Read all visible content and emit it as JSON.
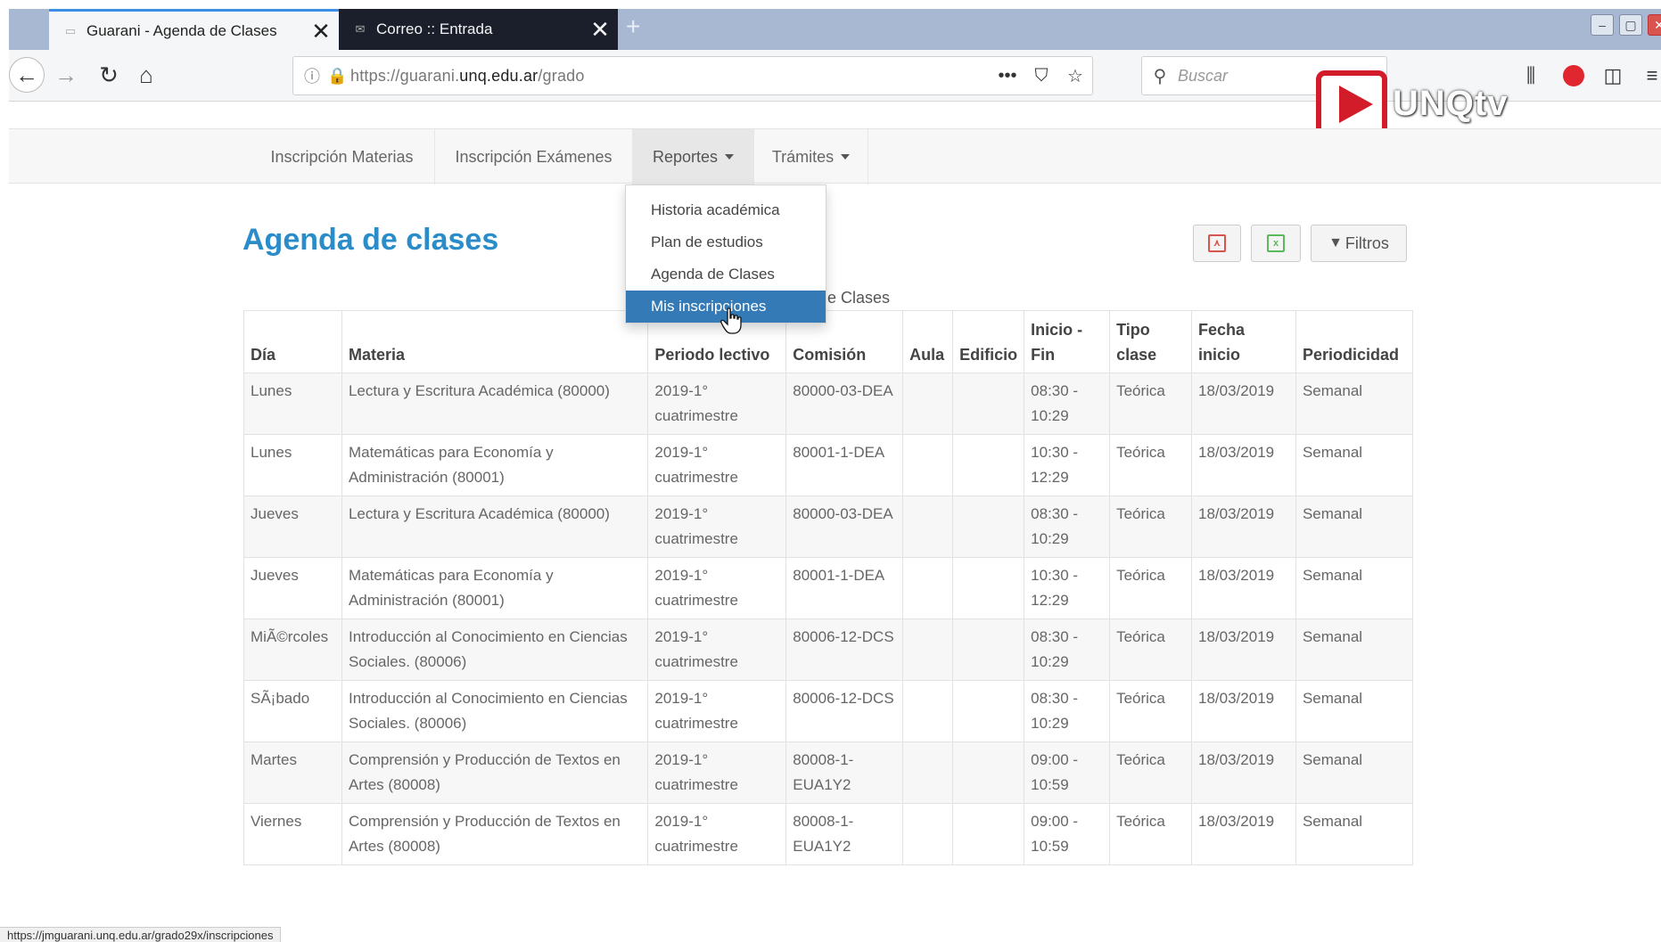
{
  "browser": {
    "tabs": [
      {
        "title": "Guarani - Agenda de Clases",
        "close": "✕"
      },
      {
        "title": "Correo :: Entrada",
        "close": "✕"
      }
    ],
    "new_tab": "+",
    "url_prefix": "https://guarani.",
    "url_domain": "unq.edu.ar",
    "url_path": "/grado",
    "url_more": "•••",
    "search_placeholder": "Buscar",
    "status_url": "https://jmguarani.unq.edu.ar/grado29x/inscripciones"
  },
  "watermark": {
    "text": "UNQtv"
  },
  "nav": {
    "items": [
      {
        "label": "Inscripción Materias"
      },
      {
        "label": "Inscripción Exámenes"
      },
      {
        "label": "Reportes"
      },
      {
        "label": "Trámites"
      }
    ]
  },
  "reportes_menu": {
    "items": [
      {
        "label": "Historia académica"
      },
      {
        "label": "Plan de estudios"
      },
      {
        "label": "Agenda de Clases"
      },
      {
        "label": "Mis inscripciones"
      }
    ]
  },
  "page": {
    "title": "Agenda de clases",
    "filter_label": "Filtros",
    "caption": "de Clases"
  },
  "table": {
    "headers": [
      "Día",
      "Materia",
      "Periodo lectivo",
      "Comisión",
      "Aula",
      "Edificio",
      "Inicio - Fin",
      "Tipo clase",
      "Fecha inicio",
      "Periodicidad"
    ],
    "rows": [
      [
        "Lunes",
        "Lectura y Escritura Académica (80000)",
        "2019-1° cuatrimestre",
        "80000-03-DEA",
        "",
        "",
        "08:30 - 10:29",
        "Teórica",
        "18/03/2019",
        "Semanal"
      ],
      [
        "Lunes",
        "Matemáticas para Economía y Administración (80001)",
        "2019-1° cuatrimestre",
        "80001-1-DEA",
        "",
        "",
        "10:30 - 12:29",
        "Teórica",
        "18/03/2019",
        "Semanal"
      ],
      [
        "Jueves",
        "Lectura y Escritura Académica (80000)",
        "2019-1° cuatrimestre",
        "80000-03-DEA",
        "",
        "",
        "08:30 - 10:29",
        "Teórica",
        "18/03/2019",
        "Semanal"
      ],
      [
        "Jueves",
        "Matemáticas para Economía y Administración (80001)",
        "2019-1° cuatrimestre",
        "80001-1-DEA",
        "",
        "",
        "10:30 - 12:29",
        "Teórica",
        "18/03/2019",
        "Semanal"
      ],
      [
        "MiÃ©rcoles",
        "Introducción al Conocimiento en Ciencias Sociales. (80006)",
        "2019-1° cuatrimestre",
        "80006-12-DCS",
        "",
        "",
        "08:30 - 10:29",
        "Teórica",
        "18/03/2019",
        "Semanal"
      ],
      [
        "SÃ¡bado",
        "Introducción al Conocimiento en Ciencias Sociales. (80006)",
        "2019-1° cuatrimestre",
        "80006-12-DCS",
        "",
        "",
        "08:30 - 10:29",
        "Teórica",
        "18/03/2019",
        "Semanal"
      ],
      [
        "Martes",
        "Comprensión y Producción de Textos en Artes (80008)",
        "2019-1° cuatrimestre",
        "80008-1-EUA1Y2",
        "",
        "",
        "09:00 - 10:59",
        "Teórica",
        "18/03/2019",
        "Semanal"
      ],
      [
        "Viernes",
        "Comprensión y Producción de Textos en Artes (80008)",
        "2019-1° cuatrimestre",
        "80008-1-EUA1Y2",
        "",
        "",
        "09:00 - 10:59",
        "Teórica",
        "18/03/2019",
        "Semanal"
      ]
    ]
  },
  "colors": {
    "title_blue": "#2a8dc9",
    "menu_active": "#337ab7",
    "pdf_red": "#d9534f",
    "excel_green": "#5cb85c"
  }
}
